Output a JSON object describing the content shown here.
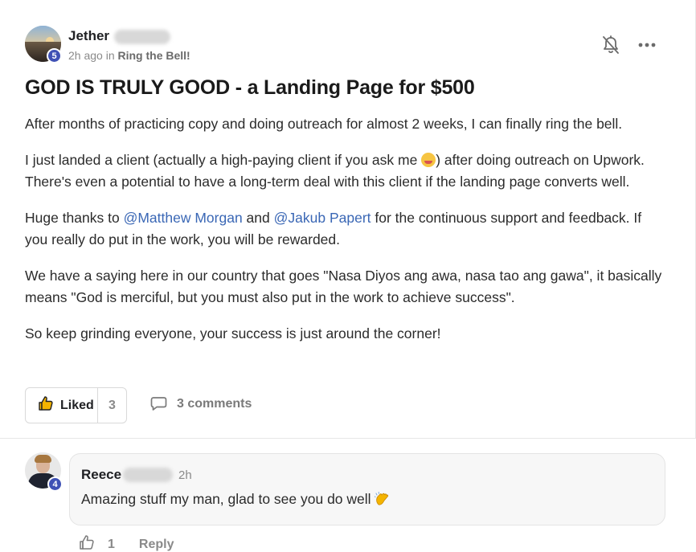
{
  "post": {
    "author": {
      "name": "Jether",
      "level": "5"
    },
    "meta": {
      "time": "2h ago in ",
      "category": "Ring the Bell!"
    },
    "title": "GOD IS TRULY GOOD - a Landing Page for $500",
    "paragraphs": {
      "p1": "After months of practicing copy and doing outreach for almost 2 weeks, I can finally ring the bell.",
      "p2a": "I just landed a client (actually a high-paying client if you ask me ",
      "p2b": ") after doing outreach on Upwork. There's even a potential to have a long-term deal with this client if the landing page converts well.",
      "p3a": "Huge thanks to ",
      "mention1": "@Matthew Morgan",
      "p3b": " and ",
      "mention2": "@Jakub Papert",
      "p3c": " for the continuous support and feedback. If you really do put in the work, you will be rewarded.",
      "p4": "We have a saying here in our country that goes \"Nasa Diyos ang awa, nasa tao ang gawa\", it basically means \"God is merciful, but you must also put in the work to achieve success\".",
      "p5": "So keep grinding everyone, your success is just around the corner!"
    },
    "actions": {
      "like_label": "Liked",
      "like_count": "3",
      "comments_label": "3 comments"
    }
  },
  "comment": {
    "author": {
      "name": "Reece",
      "level": "4"
    },
    "time": "2h",
    "text": "Amazing stuff my man, glad to see you do well",
    "like_count": "1",
    "reply_label": "Reply"
  },
  "icons": {
    "bell": "bell-muted-icon",
    "more": "more-horizontal-icon",
    "like": "thumbs-up-icon",
    "comment": "comment-bubble-icon",
    "clap": "clapping-hands-emoji"
  },
  "colors": {
    "accent": "#3f51b5",
    "mention": "#3a67b5",
    "muted": "#8a8a8a"
  }
}
